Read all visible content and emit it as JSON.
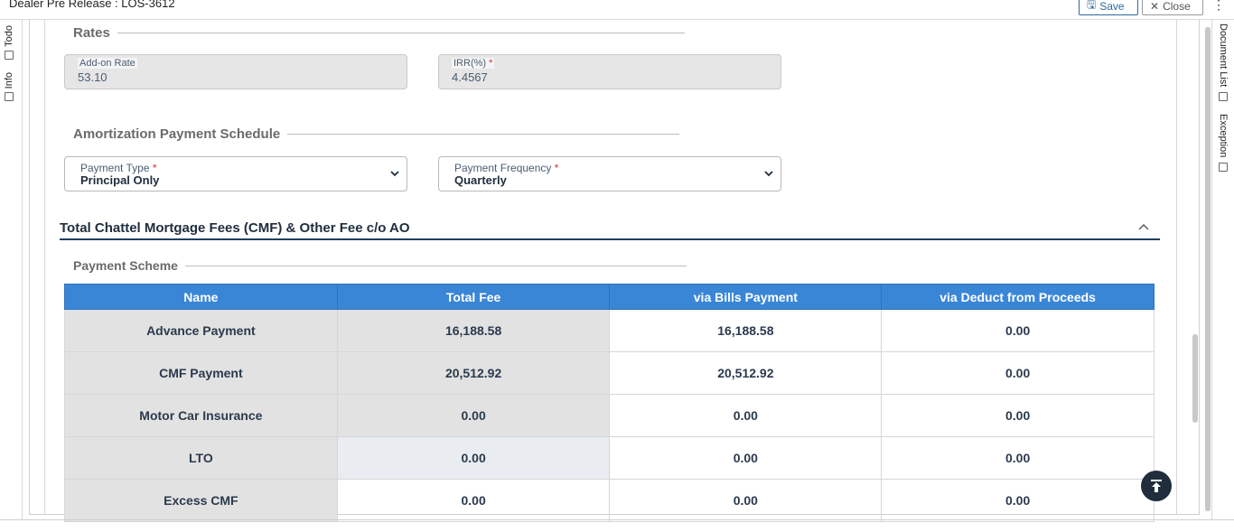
{
  "header": {
    "title": "Dealer Pre Release : LOS-3612",
    "save_label": "Save",
    "close_label": "Close"
  },
  "left_tabs": [
    {
      "label": "Todo",
      "icon": "clipboard-icon"
    },
    {
      "label": "Info",
      "icon": "clipboard-icon"
    }
  ],
  "right_tabs": [
    {
      "label": "Document List",
      "icon": "clipboard-icon"
    },
    {
      "label": "Exception",
      "icon": "clipboard-icon"
    }
  ],
  "rates": {
    "title": "Rates",
    "add_on_rate": {
      "label": "Add-on Rate",
      "value": "53.10"
    },
    "irr": {
      "label": "IRR(%)",
      "required": "*",
      "value": "4.4567"
    }
  },
  "amortization": {
    "title": "Amortization Payment Schedule",
    "payment_type": {
      "label": "Payment Type",
      "required": "*",
      "value": "Principal Only"
    },
    "payment_frequency": {
      "label": "Payment Frequency",
      "required": "*",
      "value": "Quarterly"
    }
  },
  "fees_section": {
    "title": "Total Chattel Mortgage Fees (CMF) & Other Fee c/o AO",
    "scheme_title": "Payment Scheme",
    "columns": [
      "Name",
      "Total Fee",
      "via Bills Payment",
      "via Deduct from Proceeds"
    ],
    "rows": [
      [
        "Advance Payment",
        "16,188.58",
        "16,188.58",
        "0.00"
      ],
      [
        "CMF Payment",
        "20,512.92",
        "20,512.92",
        "0.00"
      ],
      [
        "Motor Car Insurance",
        "0.00",
        "0.00",
        "0.00"
      ],
      [
        "LTO",
        "0.00",
        "0.00",
        "0.00"
      ],
      [
        "Excess CMF",
        "0.00",
        "0.00",
        "0.00"
      ]
    ]
  },
  "colors": {
    "table_header": "#3a86d6",
    "accent_dark": "#1f2d3d",
    "required": "#d93025"
  }
}
